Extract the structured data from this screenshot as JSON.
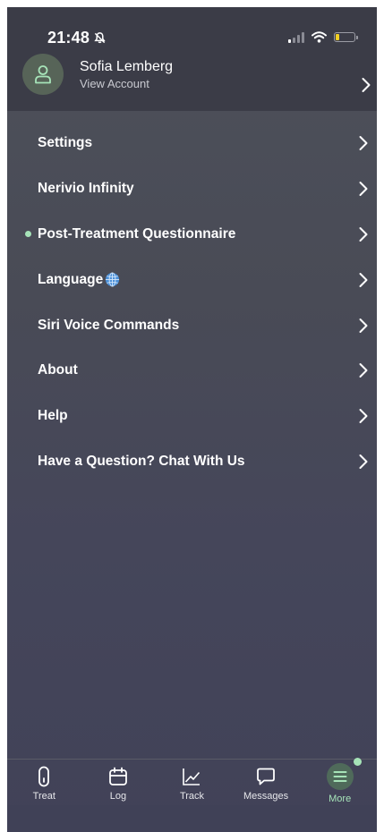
{
  "status_bar": {
    "time": "21:48"
  },
  "account": {
    "name": "Sofia Lemberg",
    "subtitle": "View Account"
  },
  "menu": {
    "items": [
      {
        "label": "Settings"
      },
      {
        "label": "Nerivio Infinity"
      },
      {
        "label": "Post-Treatment Questionnaire"
      },
      {
        "label": "Language"
      },
      {
        "label": "Siri Voice Commands"
      },
      {
        "label": "About"
      },
      {
        "label": "Help"
      },
      {
        "label": "Have a Question? Chat With Us"
      }
    ]
  },
  "tabbar": {
    "tabs": [
      {
        "label": "Treat",
        "icon": "treat-device-icon"
      },
      {
        "label": "Log",
        "icon": "calendar-icon"
      },
      {
        "label": "Track",
        "icon": "chart-line-icon"
      },
      {
        "label": "Messages",
        "icon": "chat-bubble-icon"
      },
      {
        "label": "More",
        "icon": "menu-icon",
        "active": true
      }
    ]
  },
  "colors": {
    "accent": "#a6e3b8",
    "background": "#484a55",
    "header": "#3b3c47"
  }
}
